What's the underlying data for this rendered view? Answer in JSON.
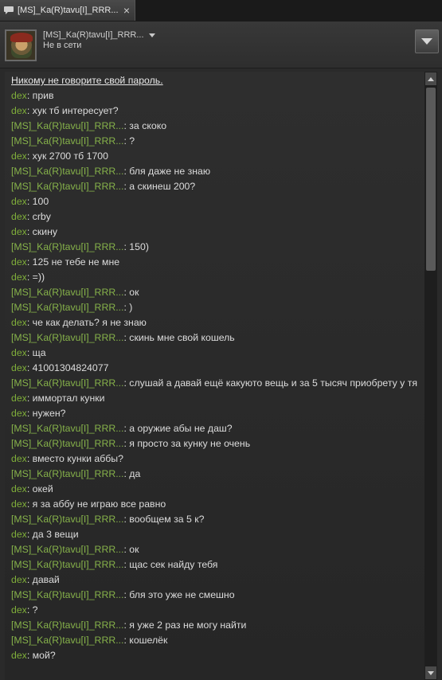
{
  "tab": {
    "title": "[MS]_Ka(R)tavu[I]_RRR...",
    "close": "×",
    "icon": "chat-bubble-icon"
  },
  "header": {
    "name": "[MS]_Ka(R)tavu[I]_RRR...",
    "status": "Не в сети"
  },
  "warning": "Никому не говорите свой пароль.",
  "messages": [
    {
      "sender": "dex",
      "text": "прив"
    },
    {
      "sender": "dex",
      "text": "хук тб интересует?"
    },
    {
      "sender": "[MS]_Ka(R)tavu[I]_RRR...",
      "text": "за скоко"
    },
    {
      "sender": "[MS]_Ka(R)tavu[I]_RRR...",
      "text": "?"
    },
    {
      "sender": "dex",
      "text": "хук 2700 тб 1700"
    },
    {
      "sender": "[MS]_Ka(R)tavu[I]_RRR...",
      "text": "бля даже не знаю"
    },
    {
      "sender": "[MS]_Ka(R)tavu[I]_RRR...",
      "text": "а скинеш 200?"
    },
    {
      "sender": "dex",
      "text": "100"
    },
    {
      "sender": "dex",
      "text": "crby"
    },
    {
      "sender": "dex",
      "text": "скину"
    },
    {
      "sender": "[MS]_Ka(R)tavu[I]_RRR...",
      "text": "150)"
    },
    {
      "sender": "dex",
      "text": "125 не тебе не мне"
    },
    {
      "sender": "dex",
      "text": "=))"
    },
    {
      "sender": "[MS]_Ka(R)tavu[I]_RRR...",
      "text": "ок"
    },
    {
      "sender": "[MS]_Ka(R)tavu[I]_RRR...",
      "text": ")"
    },
    {
      "sender": "dex",
      "text": "че как делать? я не знаю"
    },
    {
      "sender": "[MS]_Ka(R)tavu[I]_RRR...",
      "text": "скинь мне свой кошель"
    },
    {
      "sender": "dex",
      "text": "ща"
    },
    {
      "sender": "dex",
      "text": "41001304824077"
    },
    {
      "sender": "[MS]_Ka(R)tavu[I]_RRR...",
      "text": "слушай а давай ещё какуюто вещь и за 5 тысяч приобрету у тя"
    },
    {
      "sender": "dex",
      "text": "иммортал кунки"
    },
    {
      "sender": "dex",
      "text": "нужен?"
    },
    {
      "sender": "[MS]_Ka(R)tavu[I]_RRR...",
      "text": "а оружие абы не даш?"
    },
    {
      "sender": "[MS]_Ka(R)tavu[I]_RRR...",
      "text": "я просто за кунку не очень"
    },
    {
      "sender": "dex",
      "text": "вместо кунки аббы?"
    },
    {
      "sender": "[MS]_Ka(R)tavu[I]_RRR...",
      "text": "да"
    },
    {
      "sender": "dex",
      "text": "окей"
    },
    {
      "sender": "dex",
      "text": "я за аббу не играю все равно"
    },
    {
      "sender": "[MS]_Ka(R)tavu[I]_RRR...",
      "text": "вообщем за 5 к?"
    },
    {
      "sender": "dex",
      "text": "да 3 вещи"
    },
    {
      "sender": "[MS]_Ka(R)tavu[I]_RRR...",
      "text": "ок"
    },
    {
      "sender": "[MS]_Ka(R)tavu[I]_RRR...",
      "text": "щас сек найду тебя"
    },
    {
      "sender": "dex",
      "text": "давай"
    },
    {
      "sender": "[MS]_Ka(R)tavu[I]_RRR...",
      "text": "бля это уже не смешно"
    },
    {
      "sender": "dex",
      "text": "?"
    },
    {
      "sender": "[MS]_Ka(R)tavu[I]_RRR...",
      "text": "я уже 2 раз не могу найти"
    },
    {
      "sender": "[MS]_Ka(R)tavu[I]_RRR...",
      "text": "кошелёк"
    },
    {
      "sender": "dex",
      "text": "мой?"
    }
  ],
  "colors": {
    "sender_name": "#86b24a",
    "text": "#dcdcdc"
  }
}
